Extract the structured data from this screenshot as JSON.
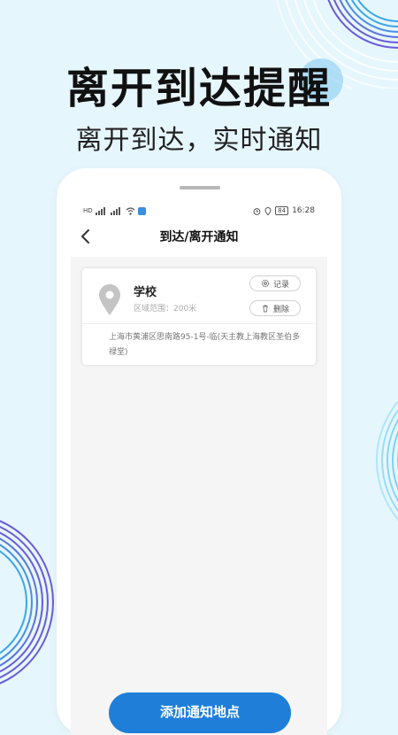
{
  "headline": "离开到达提醒",
  "subheadline": "离开到达，实时通知",
  "status_bar": {
    "network_left": "HD",
    "time": "16:28",
    "battery": "84"
  },
  "nav": {
    "title": "到达/离开通知",
    "back_icon": "chevron-left-icon"
  },
  "place": {
    "name": "学校",
    "range": "区域范围：200米",
    "record_label": "记录",
    "delete_label": "删除",
    "address": "上海市黄浦区思南路95-1号-临(天主教上海教区圣伯多禄堂)",
    "icon": "location-pin-icon"
  },
  "add_button_label": "添加通知地点",
  "colors": {
    "background": "#e6f6fd",
    "accent": "#1f7fd8",
    "ring_purple": "#6a5bd6",
    "ring_blue": "#3ba7e6"
  }
}
